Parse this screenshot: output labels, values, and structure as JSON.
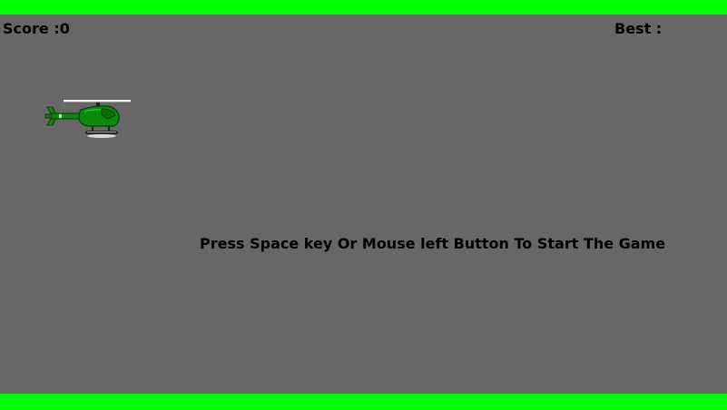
{
  "game": {
    "score_label": "Score :",
    "score_value": "0",
    "best_label": "Best :",
    "best_value": "",
    "start_prompt": "Press Space key Or Mouse left Button To Start The Game"
  },
  "colors": {
    "background": "#676767",
    "border": "#00ff00",
    "text": "#000000",
    "helicopter_body": "#0a8a0a"
  },
  "sprites": {
    "player": "helicopter-icon"
  }
}
